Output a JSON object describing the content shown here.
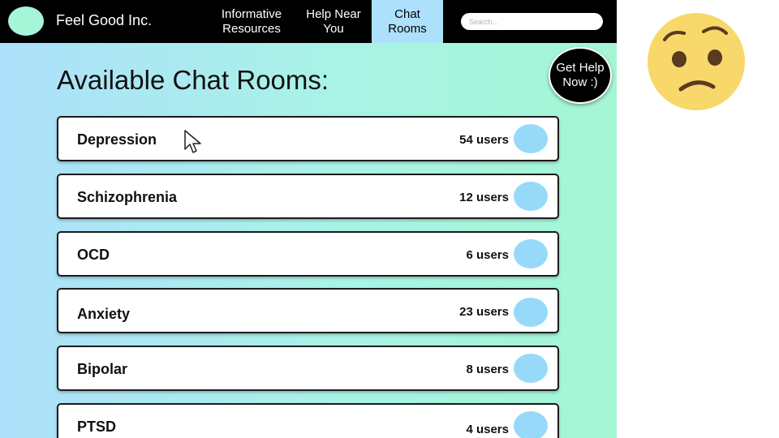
{
  "brand": {
    "name": "Feel Good Inc."
  },
  "nav": {
    "items": [
      {
        "label": "Informative\nResources"
      },
      {
        "label": "Help Near\nYou"
      },
      {
        "label": "Chat\nRooms",
        "active": true
      }
    ]
  },
  "search": {
    "placeholder": "Search..."
  },
  "main": {
    "title": "Available Chat Rooms:"
  },
  "help_button": {
    "label": "Get Help\nNow :)"
  },
  "rooms": [
    {
      "name": "Depression",
      "users": "54 users"
    },
    {
      "name": "Schizophrenia",
      "users": "12 users"
    },
    {
      "name": "OCD",
      "users": "6 users"
    },
    {
      "name": "Anxiety",
      "users": "23 users"
    },
    {
      "name": "Bipolar",
      "users": "8 users"
    },
    {
      "name": "PTSD",
      "users": "4 users"
    }
  ],
  "icons": {
    "cursor": "mouse-pointer-icon",
    "emoji": "worried-face-emoji"
  },
  "colors": {
    "navbar": "#000000",
    "nav_active": "#ade0fb",
    "gradient_left": "#ade0fb",
    "gradient_right": "#a4f6d4",
    "avatar": "#97d9f9",
    "logo": "#a7f5d8",
    "emoji_face": "#f8d86a"
  }
}
